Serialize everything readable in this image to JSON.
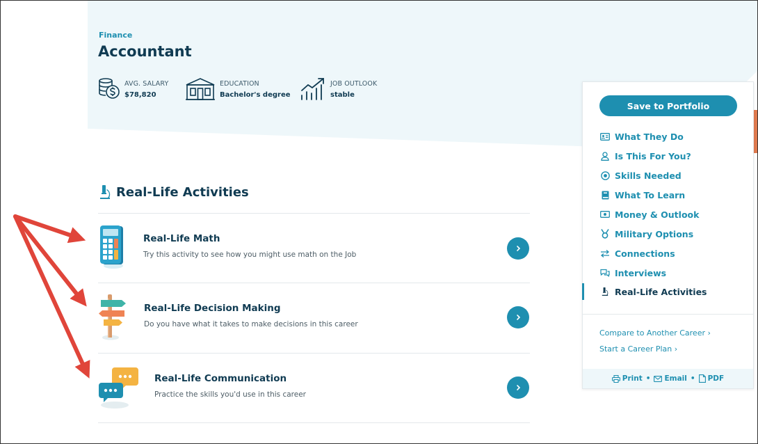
{
  "header": {
    "category": "Finance",
    "title": "Accountant",
    "stats": [
      {
        "label": "AVG. SALARY",
        "value": "$78,820",
        "icon": "money-stack-icon"
      },
      {
        "label": "EDUCATION",
        "value": "Bachelor's degree",
        "icon": "school-building-icon"
      },
      {
        "label": "JOB OUTLOOK",
        "value": "stable",
        "icon": "trend-chart-icon"
      }
    ]
  },
  "section": {
    "title": "Real-Life Activities",
    "icon": "microscope-icon"
  },
  "activities": [
    {
      "title": "Real-Life Math",
      "description": "Try this activity to see how you might use math on the Job",
      "icon": "calculator-icon"
    },
    {
      "title": "Real-Life Decision Making",
      "description": "Do you have what it takes to make decisions in this career",
      "icon": "signpost-icon"
    },
    {
      "title": "Real-Life Communication",
      "description": "Practice the skills you'd use in this career",
      "icon": "chat-bubbles-icon"
    }
  ],
  "sidebar": {
    "save_label": "Save to Portfolio",
    "nav": [
      {
        "label": "What They Do",
        "icon": "id-card-icon"
      },
      {
        "label": "Is This For You?",
        "icon": "person-icon"
      },
      {
        "label": "Skills Needed",
        "icon": "target-icon"
      },
      {
        "label": "What To Learn",
        "icon": "book-icon"
      },
      {
        "label": "Money & Outlook",
        "icon": "banknote-icon"
      },
      {
        "label": "Military Options",
        "icon": "medal-icon"
      },
      {
        "label": "Connections",
        "icon": "swap-arrows-icon"
      },
      {
        "label": "Interviews",
        "icon": "chat-icon"
      },
      {
        "label": "Real-Life Activities",
        "icon": "microscope-icon",
        "active": true
      }
    ],
    "links": {
      "compare": "Compare to Another Career ›",
      "plan": "Start a Career Plan ›"
    },
    "footer": {
      "print": "Print",
      "email": "Email",
      "pdf": "PDF",
      "separator": "•"
    }
  },
  "colors": {
    "accent": "#1e8fb0",
    "heading": "#103b52",
    "hero_bg": "#eef7fa",
    "annotation_arrow": "#e0453a",
    "strip": "#e07a4f"
  }
}
